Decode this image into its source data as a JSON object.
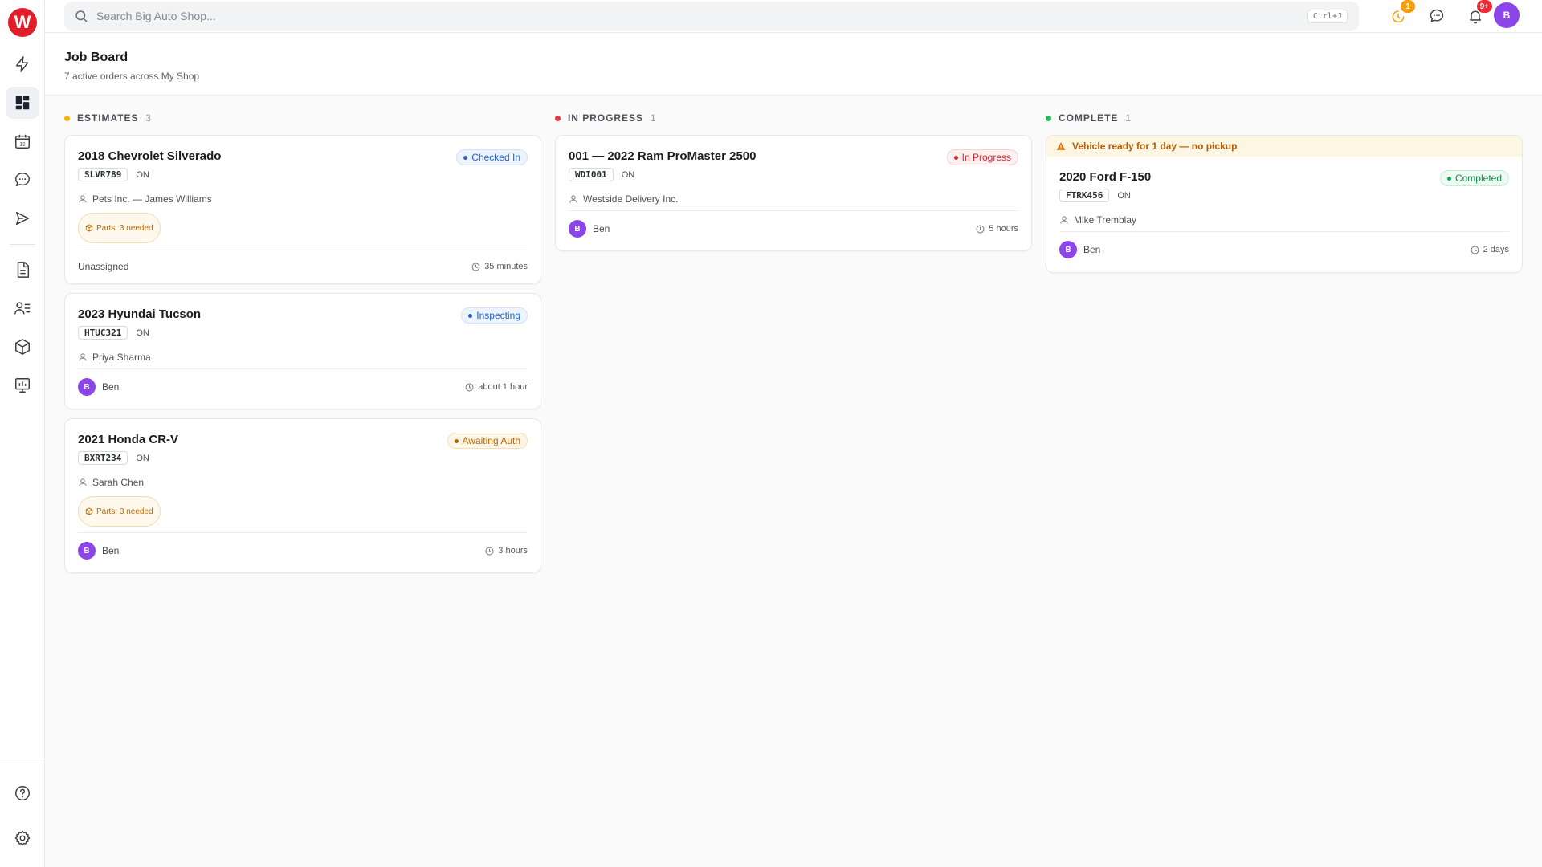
{
  "app": {
    "logo_letter": "W"
  },
  "search": {
    "placeholder": "Search Big Auto Shop...",
    "shortcut": "Ctrl+J"
  },
  "topbar": {
    "timer_badge": "1",
    "notifications_badge": "9+",
    "user_initial": "B"
  },
  "sidebar": {
    "items": [
      {
        "icon": "bolt-icon"
      },
      {
        "icon": "job-board-icon",
        "active": true
      },
      {
        "icon": "calendar-icon",
        "label": "12"
      },
      {
        "icon": "chat-icon"
      },
      {
        "icon": "campaign-icon"
      },
      {
        "icon": "document-icon"
      },
      {
        "icon": "customers-icon"
      },
      {
        "icon": "inventory-icon"
      },
      {
        "icon": "reports-icon"
      }
    ],
    "bottom": [
      {
        "icon": "help-icon"
      },
      {
        "icon": "settings-icon"
      }
    ]
  },
  "header": {
    "title": "Job Board",
    "subtitle": "7 active orders across My Shop"
  },
  "colors": {
    "estimates": "#f5b50a",
    "in_progress": "#e5353d",
    "complete": "#1fb85e",
    "avatar": "#8b45e8",
    "brand": "#e11d2a"
  },
  "columns": [
    {
      "title": "ESTIMATES",
      "count": "3",
      "cards": [
        {
          "vehicle": "2018 Chevrolet Silverado",
          "status": "Checked In",
          "plate": "SLVR789",
          "province": "ON",
          "owner": "Pets Inc. — James Williams",
          "parts": "Parts: 3 needed",
          "assignee": "Unassigned",
          "time": "35 minutes"
        },
        {
          "vehicle": "2023 Hyundai Tucson",
          "status": "Inspecting",
          "plate": "HTUC321",
          "province": "ON",
          "owner": "Priya Sharma",
          "assignee_initial": "B",
          "assignee": "Ben",
          "time": "about 1 hour"
        },
        {
          "vehicle": "2021 Honda CR-V",
          "status": "Awaiting Auth",
          "plate": "BXRT234",
          "province": "ON",
          "owner": "Sarah Chen",
          "parts": "Parts: 3 needed",
          "assignee_initial": "B",
          "assignee": "Ben",
          "time": "3 hours"
        }
      ]
    },
    {
      "title": "IN PROGRESS",
      "count": "1",
      "cards": [
        {
          "vehicle": "001 — 2022 Ram ProMaster 2500",
          "status": "In Progress",
          "plate": "WDI001",
          "province": "ON",
          "owner": "Westside Delivery Inc.",
          "assignee_initial": "B",
          "assignee": "Ben",
          "time": "5 hours"
        }
      ]
    },
    {
      "title": "COMPLETE",
      "count": "1",
      "alert": "Vehicle ready for 1 day — no pickup",
      "cards": [
        {
          "vehicle": "2020 Ford F-150",
          "status": "Completed",
          "plate": "FTRK456",
          "province": "ON",
          "owner": "Mike Tremblay",
          "assignee_initial": "B",
          "assignee": "Ben",
          "time": "2 days"
        }
      ]
    }
  ]
}
